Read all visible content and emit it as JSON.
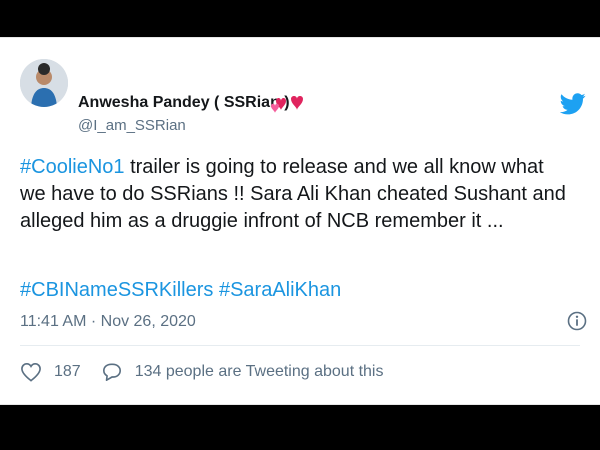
{
  "tweet": {
    "author_name": "Anwesha Pandey ( SSRian )",
    "handle": "@I_am_SSRian",
    "hashtag_lead": "#CoolieNo1",
    "body_line1_rest": " trailer is going to release and we all know what",
    "body_line2": "we have to do SSRians !! Sara Ali Khan cheated Sushant and",
    "body_line3": "alleged him as a druggie infront of NCB remember it ...",
    "hashtag1": "#CBINameSSRKillers",
    "hashtag2": "#SaraAliKhan",
    "timestamp": "11:41 AM · Nov 26, 2020",
    "likes": "187",
    "retweets_text": "134 people are Tweeting about this"
  },
  "colors": {
    "link": "#1b95e0",
    "text": "#14171a",
    "secondary": "#5b7083",
    "heart": "#e0245e",
    "brand": "#1da1f2"
  },
  "icons": [
    "twitter-bird-icon",
    "heart-emoji-icon",
    "info-icon",
    "like-heart-icon",
    "speech-bubble-icon"
  ]
}
